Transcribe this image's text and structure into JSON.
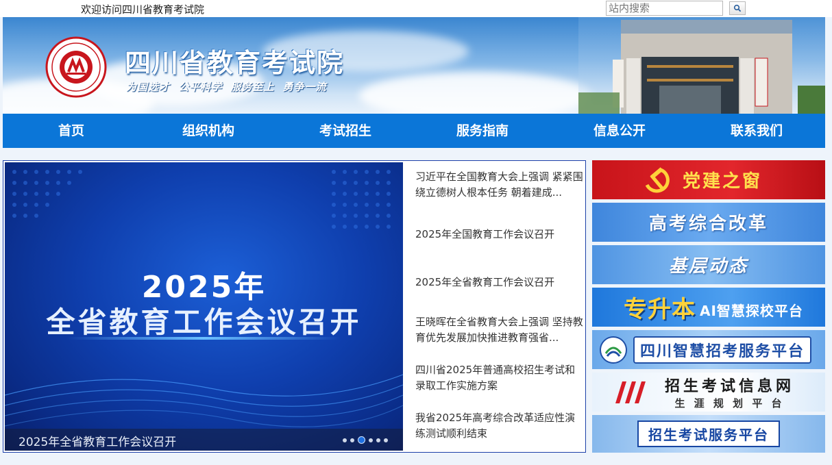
{
  "topbar": {
    "welcome": "欢迎访问四川省教育考试院",
    "search_placeholder": "站内搜索",
    "search_icon": "magnifier-icon"
  },
  "header": {
    "title": "四川省教育考试院",
    "slogan": "为国选才  公平科学  服务至上  勇争一流",
    "logo_icon": "seal-logo"
  },
  "nav": {
    "items": [
      "首页",
      "组织机构",
      "考试招生",
      "服务指南",
      "信息公开",
      "联系我们"
    ]
  },
  "slider": {
    "headline_line1": "2025年",
    "headline_line2": "全省教育工作会议召开",
    "caption": "2025年全省教育工作会议召开",
    "dot_count": 6,
    "active_dot": 2
  },
  "news": [
    "习近平在全国教育大会上强调 紧紧围绕立德树人根本任务 朝着建成...",
    "2025年全国教育工作会议召开",
    "2025年全省教育工作会议召开",
    "王晓晖在全省教育大会上强调 坚持教育优先发展加快推进教育强省...",
    "四川省2025年普通高校招生考试和录取工作实施方案",
    "我省2025年高考综合改革适应性演练测试顺利结束"
  ],
  "side_banners": [
    {
      "label": "党建之窗",
      "bg": "#c8141a",
      "fg": "#ffe14d"
    },
    {
      "label": "高考综合改革",
      "bg": "#4a92e4",
      "fg": "#ffffff"
    },
    {
      "label": "基层动态",
      "bg": "#5a9ee6",
      "fg": "#ffffff"
    },
    {
      "label_main": "专升本",
      "label_sub": "AI智慧探校平台",
      "bg": "#2f86e0",
      "fg_main": "#ffd23a",
      "fg_sub": "#ffffff"
    },
    {
      "label": "四川智慧招考服务平台",
      "bg": "#7fb6ee",
      "fg": "#ffffff",
      "tile_fg": "#1f4fa6"
    },
    {
      "label_main": "招生考试信息网",
      "label_sub": "生 涯 规 划 平 台",
      "bg": "#e8f2fc",
      "fg": "#1a1a1a",
      "accent": "#d71e28"
    },
    {
      "label": "招生考试服务平台",
      "bg": "#9cc6f0",
      "fg": "#1746a2"
    }
  ]
}
